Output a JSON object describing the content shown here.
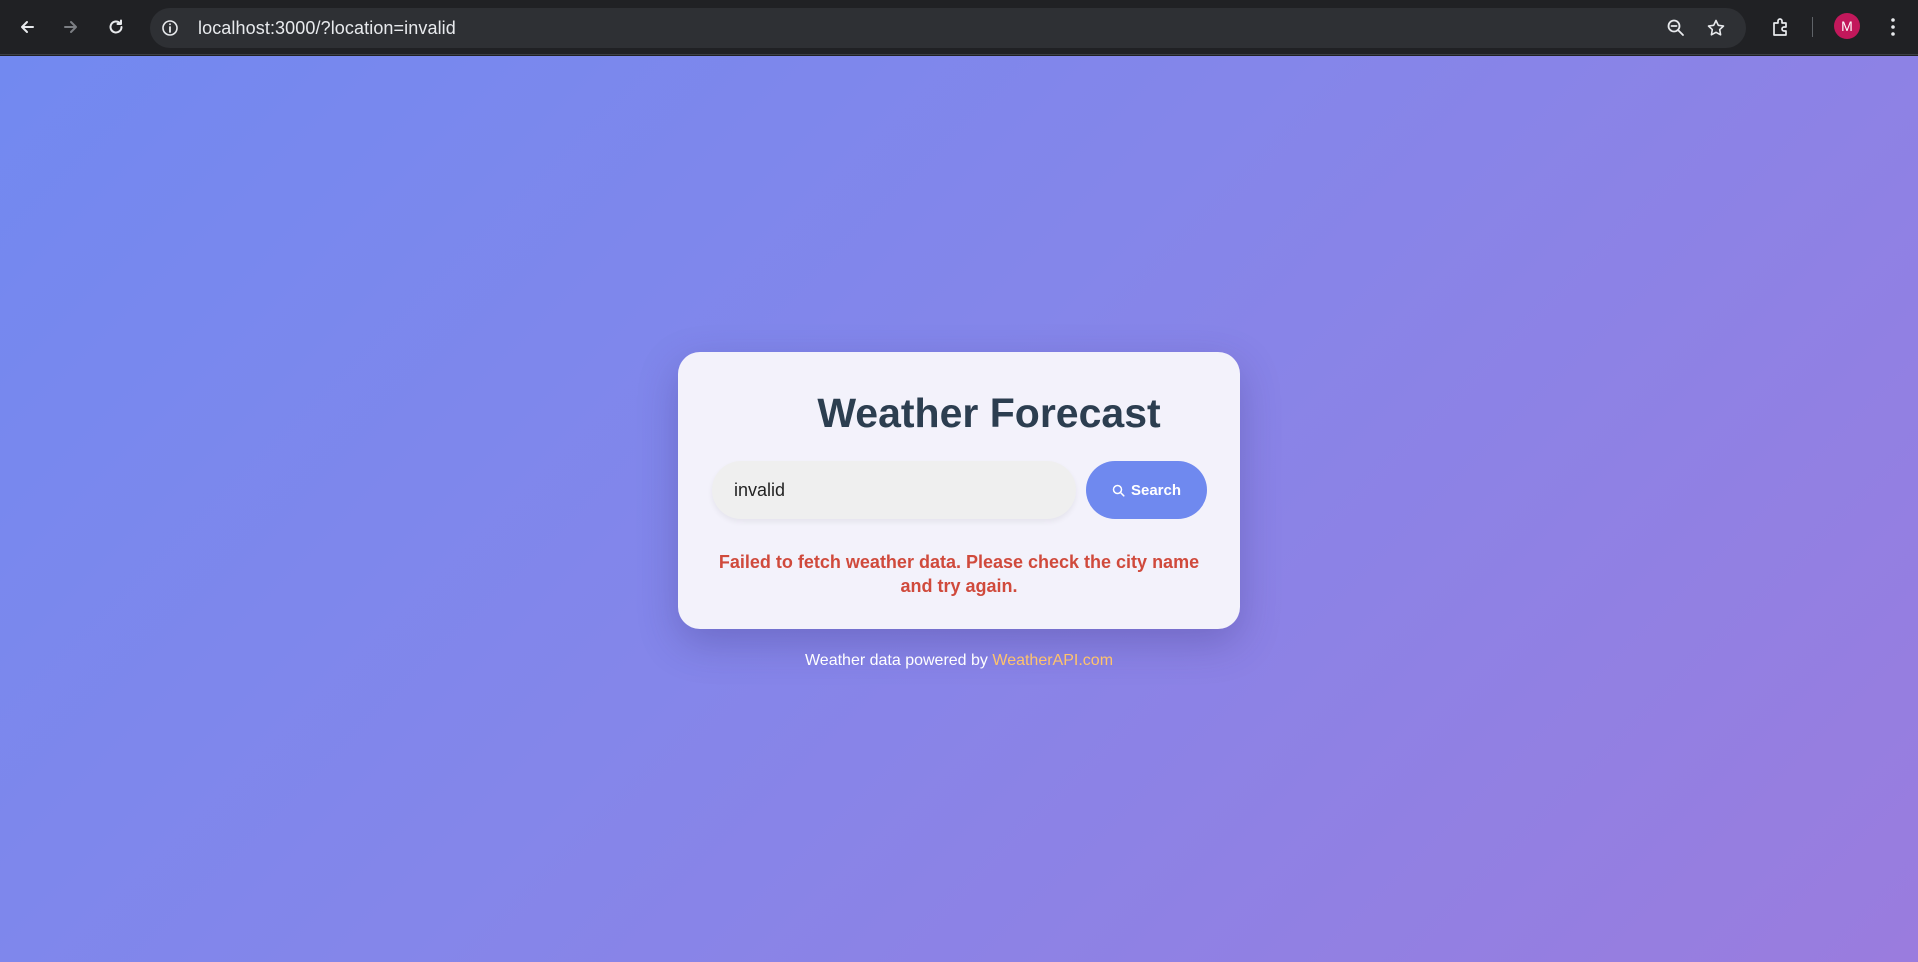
{
  "browser": {
    "url": "localhost:3000/?location=invalid",
    "profile_initial": "M",
    "icons": {
      "back": "back-arrow-icon",
      "forward": "forward-arrow-icon",
      "reload": "reload-icon",
      "site_info": "info-icon",
      "zoom": "zoom-icon",
      "bookmark": "star-icon",
      "extensions": "puzzle-icon",
      "menu": "kebab-menu-icon"
    }
  },
  "app": {
    "title": "Weather Forecast",
    "search": {
      "value": "invalid",
      "button_label": "Search",
      "button_icon": "search-icon"
    },
    "error_message": "Failed to fetch weather data. Please check the city name and try again.",
    "footer": {
      "text": "Weather data powered by",
      "link_label": "WeatherAPI.com"
    }
  },
  "colors": {
    "gradient_start": "#7289f0",
    "gradient_end": "#9a7cde",
    "button": "#6f89ef",
    "error": "#d04a3c",
    "link": "#ffc36b",
    "title": "#2c3e50"
  }
}
